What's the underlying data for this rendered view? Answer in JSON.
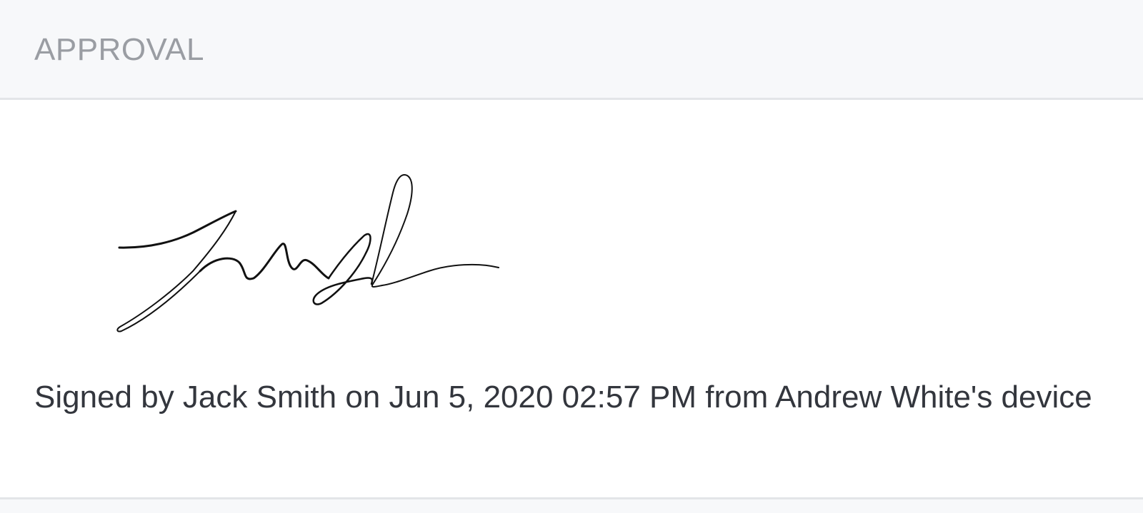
{
  "approval": {
    "section_title": "APPROVAL",
    "signature": {
      "signer_name": "Jack Smith",
      "image_label": "signature-image"
    },
    "signed_line": "Signed by Jack Smith  on Jun 5, 2020 02:57 PM from Andrew White's device"
  },
  "colors": {
    "header_background": "#f7f8fa",
    "header_text": "#9a9da3",
    "body_text": "#33363d",
    "divider": "#e3e5e8",
    "signature_ink": "#111111"
  }
}
